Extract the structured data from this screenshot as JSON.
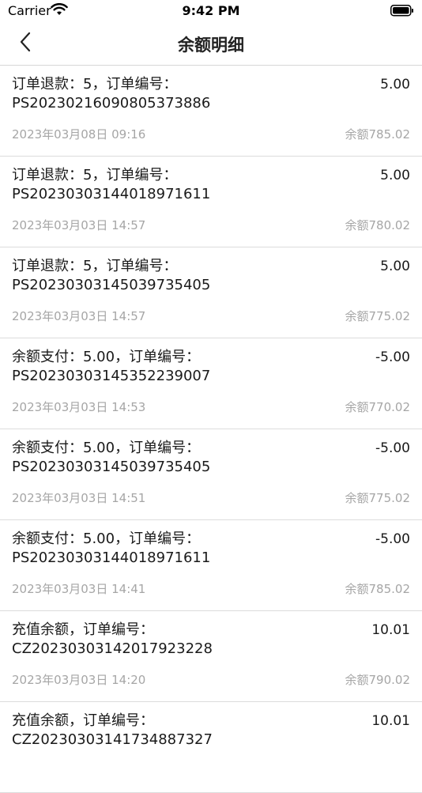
{
  "status_bar": {
    "carrier": "Carrier",
    "time": "9:42 PM"
  },
  "nav": {
    "title": "余额明细"
  },
  "records": [
    {
      "line1": "订单退款：5，订单编号：",
      "line2": "PS20230216090805373886",
      "amount": "5.00",
      "time": "2023年03月08日 09:16",
      "balance": "余额785.02"
    },
    {
      "line1": "订单退款：5，订单编号：",
      "line2": "PS20230303144018971611",
      "amount": "5.00",
      "time": "2023年03月03日 14:57",
      "balance": "余额780.02"
    },
    {
      "line1": "订单退款：5，订单编号：",
      "line2": "PS20230303145039735405",
      "amount": "5.00",
      "time": "2023年03月03日 14:57",
      "balance": "余额775.02"
    },
    {
      "line1": "余额支付：5.00，订单编号：",
      "line2": "PS20230303145352239007",
      "amount": "-5.00",
      "time": "2023年03月03日 14:53",
      "balance": "余额770.02"
    },
    {
      "line1": "余额支付：5.00，订单编号：",
      "line2": "PS20230303145039735405",
      "amount": "-5.00",
      "time": "2023年03月03日 14:51",
      "balance": "余额775.02"
    },
    {
      "line1": "余额支付：5.00，订单编号：",
      "line2": "PS20230303144018971611",
      "amount": "-5.00",
      "time": "2023年03月03日 14:41",
      "balance": "余额785.02"
    },
    {
      "line1": "充值余额，订单编号：",
      "line2": "CZ20230303142017923228",
      "amount": "10.01",
      "time": "2023年03月03日 14:20",
      "balance": "余额790.02"
    },
    {
      "line1": "充值余额，订单编号：",
      "line2": "CZ20230303141734887327",
      "amount": "10.01",
      "time": "",
      "balance": ""
    }
  ]
}
